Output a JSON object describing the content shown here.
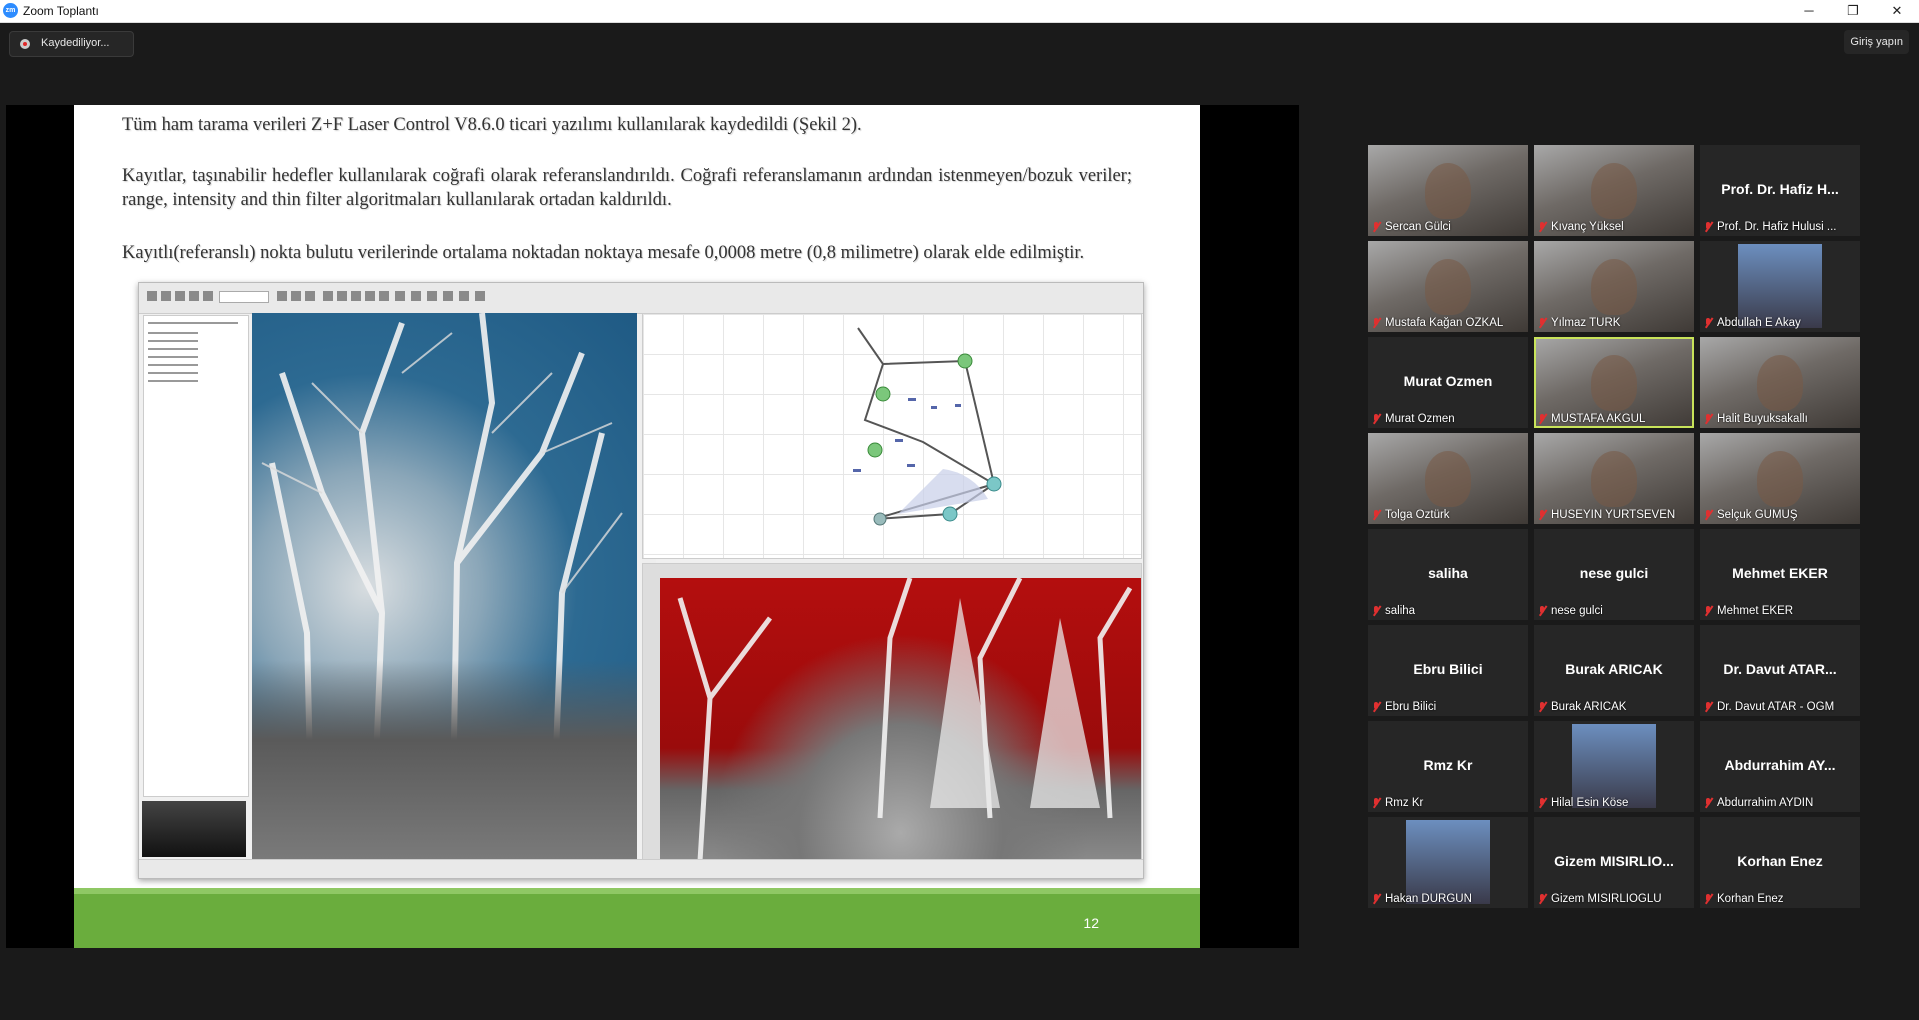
{
  "window": {
    "title": "Zoom Toplantı",
    "logo_text": "zm",
    "minimize_icon": "─",
    "maximize_icon": "❐",
    "close_icon": "✕"
  },
  "recording": {
    "label": "Kaydediliyor..."
  },
  "login": {
    "label": "Giriş yapın"
  },
  "slide": {
    "paragraph1": "Tüm ham tarama verileri Z+F Laser Control V8.6.0 ticari yazılımı kullanılarak kaydedildi (Şekil 2).",
    "paragraph2": "Kayıtlar, taşınabilir hedefler kullanılarak coğrafi olarak referanslandırıldı. Coğrafi referanslamanın ardından istenmeyen/bozuk veriler; range, intensity and thin filter algoritmaları kullanılarak ortadan kaldırıldı.",
    "paragraph3": "Kayıtlı(referanslı) nokta bulutu verilerinde ortalama noktadan noktaya mesafe 0,0008 metre (0,8 milimetre) olarak elde edilmiştir.",
    "page_number": "12"
  },
  "participants": [
    {
      "tile": "Sercan Gülci",
      "name": "Sercan Gülci",
      "video": true
    },
    {
      "tile": "Kıvanç Yüksel",
      "name": "Kıvanç Yüksel",
      "video": true
    },
    {
      "tile": "Prof. Dr. Hafiz H...",
      "name": "Prof. Dr. Hafiz Hulusi ...",
      "video": false
    },
    {
      "tile": "Mustafa Kağan ÖZKAL",
      "name": "Mustafa Kağan ÖZKAL",
      "video": true
    },
    {
      "tile": "Yılmaz TÜRK",
      "name": "Yılmaz TÜRK",
      "video": true
    },
    {
      "tile": "Abdullah E Akay",
      "name": "Abdullah E Akay",
      "video": false,
      "photo": true
    },
    {
      "tile": "Murat Ozmen",
      "name": "Murat Ozmen",
      "video": false
    },
    {
      "tile": "MUSTAFA AKGÜL",
      "name": "MUSTAFA AKGÜL",
      "video": true,
      "active": true
    },
    {
      "tile": "Halit Buyuksakalli",
      "name": "Halit Buyuksakallı",
      "video": true
    },
    {
      "tile": "Tolga Öztürk",
      "name": "Tolga Öztürk",
      "video": true
    },
    {
      "tile": "HÜSEYİN YURTSEVEN",
      "name": "HÜSEYİN YURTSEVEN",
      "video": true
    },
    {
      "tile": "Selçuk GÜMÜŞ",
      "name": "Selçuk GÜMÜŞ",
      "video": true
    },
    {
      "tile": "saliha",
      "name": "saliha",
      "video": false
    },
    {
      "tile": "nese gulci",
      "name": "nese gulci",
      "video": false
    },
    {
      "tile": "Mehmet EKER",
      "name": "Mehmet EKER",
      "video": false
    },
    {
      "tile": "Ebru Bilici",
      "name": "Ebru Bilici",
      "video": false
    },
    {
      "tile": "Burak ARICAK",
      "name": "Burak ARICAK",
      "video": false
    },
    {
      "tile": "Dr. Davut ATAR...",
      "name": "Dr. Davut ATAR - OGM",
      "video": false
    },
    {
      "tile": "Rmz Kr",
      "name": "Rmz Kr",
      "video": false
    },
    {
      "tile": "Hilal Esin Köse",
      "name": "Hilal Esin Köse",
      "video": false,
      "photo": true
    },
    {
      "tile": "Abdurrahim AY...",
      "name": "Abdurrahim AYDIN",
      "video": false
    },
    {
      "tile": "Hakan DURGUN",
      "name": "Hakan DURGUN",
      "video": false,
      "photo": true
    },
    {
      "tile": "Gizem MISIRLIO...",
      "name": "Gizem MISIRLIOGLU",
      "video": false
    },
    {
      "tile": "Korhan Enez",
      "name": "Korhan Enez",
      "video": false
    }
  ]
}
